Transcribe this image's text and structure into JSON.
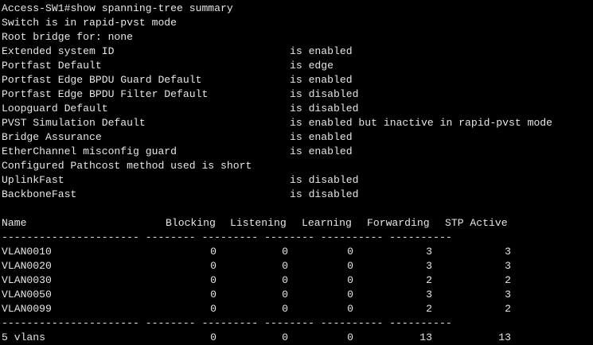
{
  "terminal": {
    "prompt": "Access-SW1#",
    "command": "show spanning-tree summary",
    "mode_line": "Switch is in rapid-pvst mode",
    "root_line": "Root bridge for: none",
    "settings": [
      {
        "name": "Extended system ID",
        "value": "is enabled"
      },
      {
        "name": "Portfast Default",
        "value": "is edge"
      },
      {
        "name": "Portfast Edge BPDU Guard Default",
        "value": "is enabled"
      },
      {
        "name": "Portfast Edge BPDU Filter Default",
        "value": "is disabled"
      },
      {
        "name": "Loopguard Default",
        "value": "is disabled"
      },
      {
        "name": "PVST Simulation Default",
        "value": "is enabled but inactive in rapid-pvst mode"
      },
      {
        "name": "Bridge Assurance",
        "value": "is enabled"
      },
      {
        "name": "EtherChannel misconfig guard",
        "value": "is enabled"
      }
    ],
    "pathcost_line": "Configured Pathcost method used is short",
    "settings2": [
      {
        "name": "UplinkFast",
        "value": "is disabled"
      },
      {
        "name": "BackboneFast",
        "value": "is disabled"
      }
    ],
    "table": {
      "headers": [
        "Name",
        "Blocking",
        "Listening",
        "Learning",
        "Forwarding",
        "STP Active"
      ],
      "separator": "---------------------- -------- --------- -------- ---------- ----------",
      "rows": [
        {
          "name": "VLAN0010",
          "blocking": "0",
          "listening": "0",
          "learning": "0",
          "forwarding": "3",
          "active": "3"
        },
        {
          "name": "VLAN0020",
          "blocking": "0",
          "listening": "0",
          "learning": "0",
          "forwarding": "3",
          "active": "3"
        },
        {
          "name": "VLAN0030",
          "blocking": "0",
          "listening": "0",
          "learning": "0",
          "forwarding": "2",
          "active": "2"
        },
        {
          "name": "VLAN0050",
          "blocking": "0",
          "listening": "0",
          "learning": "0",
          "forwarding": "3",
          "active": "3"
        },
        {
          "name": "VLAN0099",
          "blocking": "0",
          "listening": "0",
          "learning": "0",
          "forwarding": "2",
          "active": "2"
        }
      ],
      "total": {
        "name": "5 vlans",
        "blocking": "0",
        "listening": "0",
        "learning": "0",
        "forwarding": "13",
        "active": "13"
      }
    }
  },
  "colors": {
    "background": "#000000",
    "text": "#e6e6e6"
  }
}
